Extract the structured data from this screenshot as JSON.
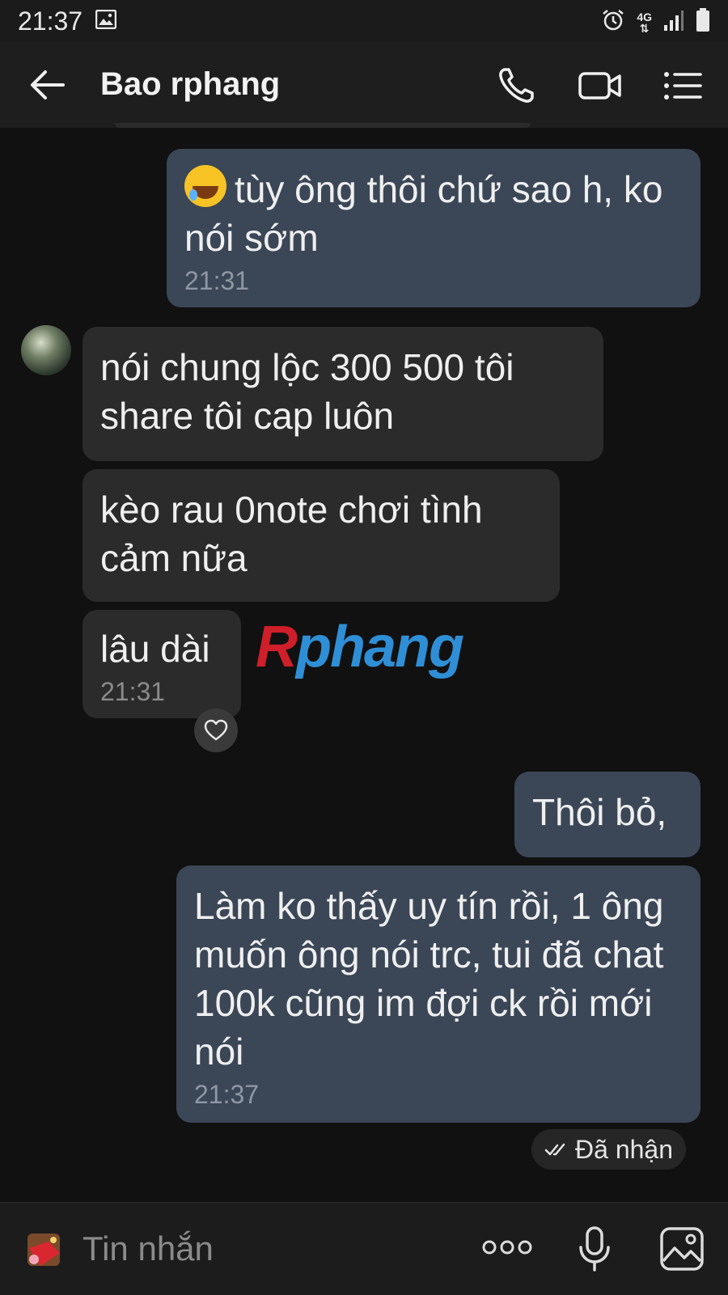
{
  "status_bar": {
    "time": "21:37",
    "network": "4G"
  },
  "header": {
    "title": "Bao rphang"
  },
  "messages": {
    "m1": {
      "text": "tùy ông thôi chứ sao h, ko nói sớm",
      "time": "21:31"
    },
    "m2": {
      "text": "nói chung lộc 300 500 tôi share tôi cap luôn"
    },
    "m3": {
      "text": "kèo rau 0note chơi tình cảm nữa"
    },
    "m4": {
      "text": "lâu dài",
      "time": "21:31"
    },
    "m5": {
      "text": "Thôi bỏ,"
    },
    "m6": {
      "text": "Làm ko thấy uy tín rồi, 1 ông muốn ông nói trc, tui đã chat 100k cũng im đợi ck rồi mới nói",
      "time": "21:37"
    }
  },
  "watermark": {
    "first": "R",
    "rest": "phang"
  },
  "delivery_status": "Đã nhận",
  "composer": {
    "placeholder": "Tin nhắn"
  },
  "icons": [
    "back-arrow-icon",
    "phone-icon",
    "video-camera-icon",
    "list-menu-icon",
    "heart-icon",
    "double-check-icon",
    "sticker-icon",
    "more-dots-icon",
    "microphone-icon",
    "image-gallery-icon"
  ],
  "colors": {
    "background": "#111111",
    "outgoing_bubble": "#3b4757",
    "incoming_bubble": "#2b2b2b"
  }
}
